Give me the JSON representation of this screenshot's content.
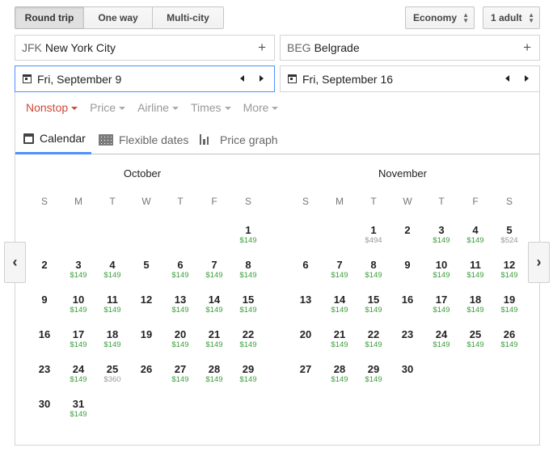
{
  "trip_types": [
    {
      "label": "Round trip",
      "active": true
    },
    {
      "label": "One way",
      "active": false
    },
    {
      "label": "Multi-city",
      "active": false
    }
  ],
  "cabin": {
    "value": "Economy"
  },
  "passengers": {
    "value": "1 adult"
  },
  "origin": {
    "code": "JFK",
    "city": "New York City"
  },
  "destination": {
    "code": "BEG",
    "city": "Belgrade"
  },
  "depart": {
    "date": "Fri, September 9"
  },
  "return": {
    "date": "Fri, September 16"
  },
  "filters": [
    {
      "label": "Nonstop",
      "active": true
    },
    {
      "label": "Price",
      "active": false
    },
    {
      "label": "Airline",
      "active": false
    },
    {
      "label": "Times",
      "active": false
    },
    {
      "label": "More",
      "active": false
    }
  ],
  "views": {
    "calendar": "Calendar",
    "flexible": "Flexible dates",
    "price_graph": "Price graph"
  },
  "weekdays": [
    "S",
    "M",
    "T",
    "W",
    "T",
    "F",
    "S"
  ],
  "months": [
    {
      "name": "October",
      "first_weekday": 6,
      "days": [
        {
          "d": "1",
          "p": "$149"
        },
        {
          "d": "2",
          "p": ""
        },
        {
          "d": "3",
          "p": "$149"
        },
        {
          "d": "4",
          "p": "$149"
        },
        {
          "d": "5",
          "p": ""
        },
        {
          "d": "6",
          "p": "$149"
        },
        {
          "d": "7",
          "p": "$149"
        },
        {
          "d": "8",
          "p": "$149"
        },
        {
          "d": "9",
          "p": ""
        },
        {
          "d": "10",
          "p": "$149"
        },
        {
          "d": "11",
          "p": "$149"
        },
        {
          "d": "12",
          "p": ""
        },
        {
          "d": "13",
          "p": "$149"
        },
        {
          "d": "14",
          "p": "$149"
        },
        {
          "d": "15",
          "p": "$149"
        },
        {
          "d": "16",
          "p": ""
        },
        {
          "d": "17",
          "p": "$149"
        },
        {
          "d": "18",
          "p": "$149"
        },
        {
          "d": "19",
          "p": ""
        },
        {
          "d": "20",
          "p": "$149"
        },
        {
          "d": "21",
          "p": "$149"
        },
        {
          "d": "22",
          "p": "$149"
        },
        {
          "d": "23",
          "p": ""
        },
        {
          "d": "24",
          "p": "$149"
        },
        {
          "d": "25",
          "p": "$360",
          "gray": true
        },
        {
          "d": "26",
          "p": ""
        },
        {
          "d": "27",
          "p": "$149"
        },
        {
          "d": "28",
          "p": "$149"
        },
        {
          "d": "29",
          "p": "$149"
        },
        {
          "d": "30",
          "p": ""
        },
        {
          "d": "31",
          "p": "$149"
        }
      ]
    },
    {
      "name": "November",
      "first_weekday": 2,
      "days": [
        {
          "d": "1",
          "p": "$494",
          "gray": true
        },
        {
          "d": "2",
          "p": ""
        },
        {
          "d": "3",
          "p": "$149"
        },
        {
          "d": "4",
          "p": "$149"
        },
        {
          "d": "5",
          "p": "$524",
          "gray": true
        },
        {
          "d": "6",
          "p": ""
        },
        {
          "d": "7",
          "p": "$149"
        },
        {
          "d": "8",
          "p": "$149"
        },
        {
          "d": "9",
          "p": ""
        },
        {
          "d": "10",
          "p": "$149"
        },
        {
          "d": "11",
          "p": "$149"
        },
        {
          "d": "12",
          "p": "$149"
        },
        {
          "d": "13",
          "p": ""
        },
        {
          "d": "14",
          "p": "$149"
        },
        {
          "d": "15",
          "p": "$149"
        },
        {
          "d": "16",
          "p": ""
        },
        {
          "d": "17",
          "p": "$149"
        },
        {
          "d": "18",
          "p": "$149"
        },
        {
          "d": "19",
          "p": "$149"
        },
        {
          "d": "20",
          "p": ""
        },
        {
          "d": "21",
          "p": "$149"
        },
        {
          "d": "22",
          "p": "$149"
        },
        {
          "d": "23",
          "p": ""
        },
        {
          "d": "24",
          "p": "$149"
        },
        {
          "d": "25",
          "p": "$149"
        },
        {
          "d": "26",
          "p": "$149"
        },
        {
          "d": "27",
          "p": ""
        },
        {
          "d": "28",
          "p": "$149"
        },
        {
          "d": "29",
          "p": "$149"
        },
        {
          "d": "30",
          "p": ""
        }
      ]
    }
  ],
  "colors": {
    "price": "#3c9e3c",
    "price_high": "#999999",
    "accent": "#4d90fe",
    "filter_active": "#d14836"
  },
  "icons": {
    "prev": "chevron-left-icon",
    "next": "chevron-right-icon",
    "add": "plus-icon",
    "date": "calendar-icon"
  }
}
